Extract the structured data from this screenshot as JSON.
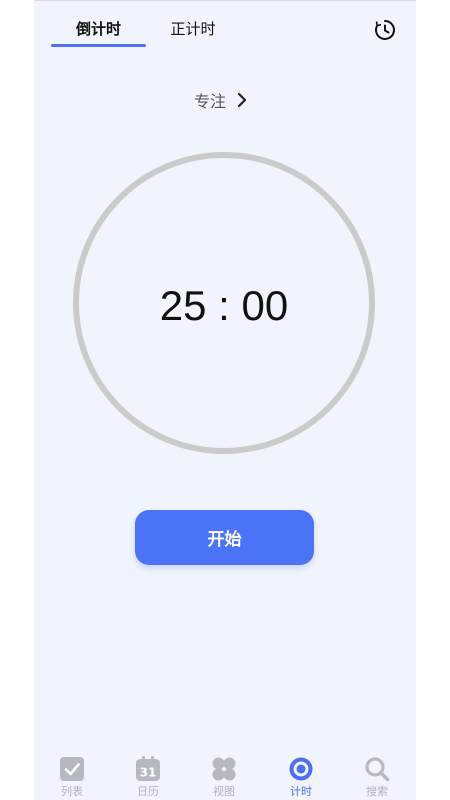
{
  "tabs": {
    "countdown": "倒计时",
    "countup": "正计时",
    "active": "countdown"
  },
  "focus": {
    "label": "专注"
  },
  "timer": {
    "display": "25 : 00"
  },
  "start_button": {
    "label": "开始"
  },
  "bottom_nav": {
    "items": [
      {
        "label": "列表",
        "icon": "checkbox-icon"
      },
      {
        "label": "日历",
        "icon": "calendar-icon",
        "badge": "31"
      },
      {
        "label": "视图",
        "icon": "grid-view-icon"
      },
      {
        "label": "计时",
        "icon": "timer-icon"
      },
      {
        "label": "搜索",
        "icon": "search-icon"
      }
    ],
    "active_index": 3
  },
  "colors": {
    "accent": "#4a73f6",
    "background": "#f1f3fd",
    "ring": "#cbcbcb",
    "nav_inactive": "#b0b3bb"
  }
}
